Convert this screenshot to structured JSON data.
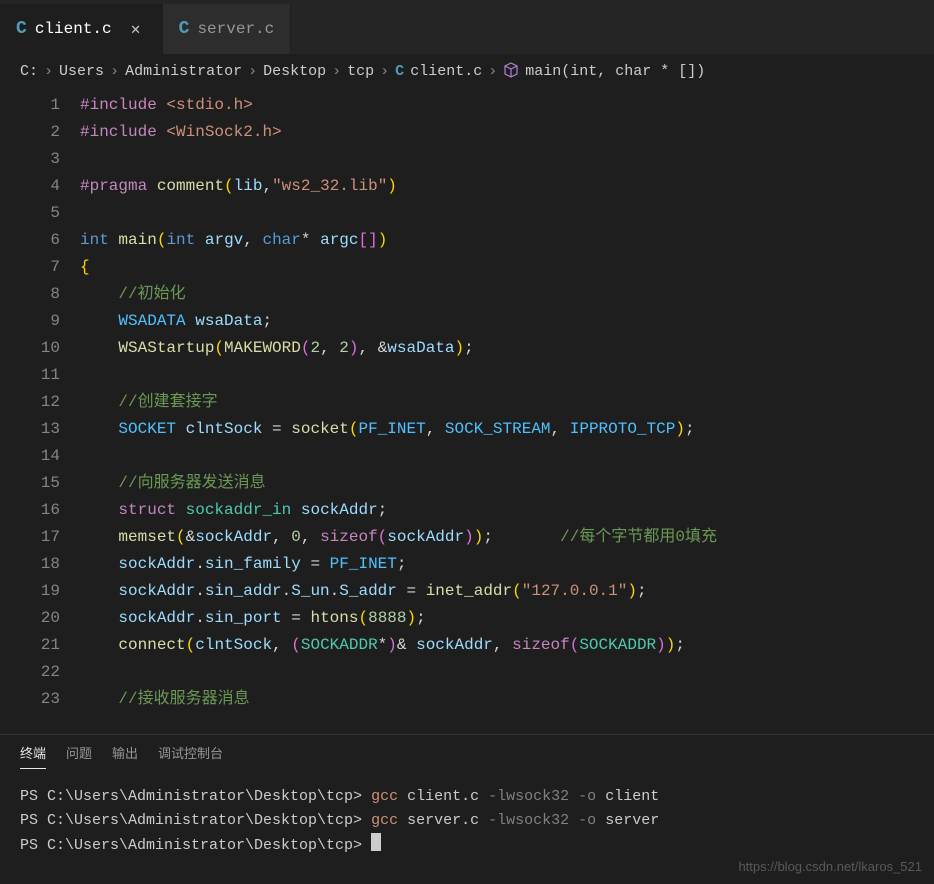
{
  "tabs": [
    {
      "icon": "C",
      "name": "client.c",
      "active": true,
      "closeable": true
    },
    {
      "icon": "C",
      "name": "server.c",
      "active": false,
      "closeable": false
    }
  ],
  "breadcrumb": {
    "parts": [
      "C:",
      "Users",
      "Administrator",
      "Desktop",
      "tcp"
    ],
    "file": "client.c",
    "symbol": "main(int, char * [])"
  },
  "code_lines": [
    {
      "n": 1,
      "tokens": [
        [
          "kw",
          "#include"
        ],
        [
          "ws",
          " "
        ],
        [
          "hdr",
          "<stdio.h>"
        ]
      ]
    },
    {
      "n": 2,
      "tokens": [
        [
          "kw",
          "#include"
        ],
        [
          "ws",
          " "
        ],
        [
          "hdr",
          "<WinSock2.h>"
        ]
      ]
    },
    {
      "n": 3,
      "tokens": []
    },
    {
      "n": 4,
      "tokens": [
        [
          "kw",
          "#pragma"
        ],
        [
          "ws",
          " "
        ],
        [
          "func",
          "comment"
        ],
        [
          "yparen",
          "("
        ],
        [
          "var",
          "lib"
        ],
        [
          "semi",
          ","
        ],
        [
          "str",
          "\"ws2_32.lib\""
        ],
        [
          "yparen",
          ")"
        ]
      ]
    },
    {
      "n": 5,
      "tokens": []
    },
    {
      "n": 6,
      "tokens": [
        [
          "type",
          "int"
        ],
        [
          "ws",
          " "
        ],
        [
          "func",
          "main"
        ],
        [
          "yparen",
          "("
        ],
        [
          "type",
          "int"
        ],
        [
          "ws",
          " "
        ],
        [
          "var",
          "argv"
        ],
        [
          "semi",
          ", "
        ],
        [
          "type",
          "char"
        ],
        [
          "semi",
          "*"
        ],
        [
          "ws",
          " "
        ],
        [
          "var",
          "argc"
        ],
        [
          "pink",
          "["
        ],
        [
          "pink",
          "]"
        ],
        [
          "yparen",
          ")"
        ]
      ]
    },
    {
      "n": 7,
      "tokens": [
        [
          "bracey",
          "{"
        ]
      ]
    },
    {
      "n": 8,
      "tokens": [
        [
          "ws",
          "    "
        ],
        [
          "cmt",
          "//初始化"
        ]
      ]
    },
    {
      "n": 9,
      "tokens": [
        [
          "ws",
          "    "
        ],
        [
          "def",
          "WSADATA"
        ],
        [
          "ws",
          " "
        ],
        [
          "var",
          "wsaData"
        ],
        [
          "semi",
          ";"
        ]
      ]
    },
    {
      "n": 10,
      "tokens": [
        [
          "ws",
          "    "
        ],
        [
          "func",
          "WSAStartup"
        ],
        [
          "yparen",
          "("
        ],
        [
          "func",
          "MAKEWORD"
        ],
        [
          "pink",
          "("
        ],
        [
          "num",
          "2"
        ],
        [
          "semi",
          ", "
        ],
        [
          "num",
          "2"
        ],
        [
          "pink",
          ")"
        ],
        [
          "semi",
          ", "
        ],
        [
          "semi",
          "&"
        ],
        [
          "var",
          "wsaData"
        ],
        [
          "yparen",
          ")"
        ],
        [
          "semi",
          ";"
        ]
      ]
    },
    {
      "n": 11,
      "tokens": []
    },
    {
      "n": 12,
      "tokens": [
        [
          "ws",
          "    "
        ],
        [
          "cmt",
          "//创建套接字"
        ]
      ]
    },
    {
      "n": 13,
      "tokens": [
        [
          "ws",
          "    "
        ],
        [
          "def",
          "SOCKET"
        ],
        [
          "ws",
          " "
        ],
        [
          "var",
          "clntSock"
        ],
        [
          "ws",
          " "
        ],
        [
          "semi",
          "="
        ],
        [
          "ws",
          " "
        ],
        [
          "func",
          "socket"
        ],
        [
          "yparen",
          "("
        ],
        [
          "def",
          "PF_INET"
        ],
        [
          "semi",
          ", "
        ],
        [
          "def",
          "SOCK_STREAM"
        ],
        [
          "semi",
          ", "
        ],
        [
          "def",
          "IPPROTO_TCP"
        ],
        [
          "yparen",
          ")"
        ],
        [
          "semi",
          ";"
        ]
      ]
    },
    {
      "n": 14,
      "tokens": []
    },
    {
      "n": 15,
      "tokens": [
        [
          "ws",
          "    "
        ],
        [
          "cmt",
          "//向服务器发送消息"
        ]
      ]
    },
    {
      "n": 16,
      "tokens": [
        [
          "ws",
          "    "
        ],
        [
          "kw",
          "struct"
        ],
        [
          "ws",
          " "
        ],
        [
          "typeid",
          "sockaddr_in"
        ],
        [
          "ws",
          " "
        ],
        [
          "var",
          "sockAddr"
        ],
        [
          "semi",
          ";"
        ]
      ]
    },
    {
      "n": 17,
      "tokens": [
        [
          "ws",
          "    "
        ],
        [
          "func",
          "memset"
        ],
        [
          "yparen",
          "("
        ],
        [
          "semi",
          "&"
        ],
        [
          "var",
          "sockAddr"
        ],
        [
          "semi",
          ", "
        ],
        [
          "num",
          "0"
        ],
        [
          "semi",
          ", "
        ],
        [
          "kw",
          "sizeof"
        ],
        [
          "pink",
          "("
        ],
        [
          "var",
          "sockAddr"
        ],
        [
          "pink",
          ")"
        ],
        [
          "yparen",
          ")"
        ],
        [
          "semi",
          ";"
        ],
        [
          "ws",
          "       "
        ],
        [
          "cmt",
          "//每个字节都用0填充"
        ]
      ]
    },
    {
      "n": 18,
      "tokens": [
        [
          "ws",
          "    "
        ],
        [
          "var",
          "sockAddr"
        ],
        [
          "semi",
          "."
        ],
        [
          "var",
          "sin_family"
        ],
        [
          "ws",
          " "
        ],
        [
          "semi",
          "="
        ],
        [
          "ws",
          " "
        ],
        [
          "def",
          "PF_INET"
        ],
        [
          "semi",
          ";"
        ]
      ]
    },
    {
      "n": 19,
      "tokens": [
        [
          "ws",
          "    "
        ],
        [
          "var",
          "sockAddr"
        ],
        [
          "semi",
          "."
        ],
        [
          "var",
          "sin_addr"
        ],
        [
          "semi",
          "."
        ],
        [
          "var",
          "S_un"
        ],
        [
          "semi",
          "."
        ],
        [
          "var",
          "S_addr"
        ],
        [
          "ws",
          " "
        ],
        [
          "semi",
          "="
        ],
        [
          "ws",
          " "
        ],
        [
          "func",
          "inet_addr"
        ],
        [
          "yparen",
          "("
        ],
        [
          "str",
          "\"127.0.0.1\""
        ],
        [
          "yparen",
          ")"
        ],
        [
          "semi",
          ";"
        ]
      ]
    },
    {
      "n": 20,
      "tokens": [
        [
          "ws",
          "    "
        ],
        [
          "var",
          "sockAddr"
        ],
        [
          "semi",
          "."
        ],
        [
          "var",
          "sin_port"
        ],
        [
          "ws",
          " "
        ],
        [
          "semi",
          "="
        ],
        [
          "ws",
          " "
        ],
        [
          "func",
          "htons"
        ],
        [
          "yparen",
          "("
        ],
        [
          "num",
          "8888"
        ],
        [
          "yparen",
          ")"
        ],
        [
          "semi",
          ";"
        ]
      ]
    },
    {
      "n": 21,
      "tokens": [
        [
          "ws",
          "    "
        ],
        [
          "func",
          "connect"
        ],
        [
          "yparen",
          "("
        ],
        [
          "var",
          "clntSock"
        ],
        [
          "semi",
          ", "
        ],
        [
          "pink",
          "("
        ],
        [
          "typeid",
          "SOCKADDR"
        ],
        [
          "semi",
          "*"
        ],
        [
          "pink",
          ")"
        ],
        [
          "semi",
          "& "
        ],
        [
          "var",
          "sockAddr"
        ],
        [
          "semi",
          ", "
        ],
        [
          "kw",
          "sizeof"
        ],
        [
          "pink",
          "("
        ],
        [
          "typeid",
          "SOCKADDR"
        ],
        [
          "pink",
          ")"
        ],
        [
          "yparen",
          ")"
        ],
        [
          "semi",
          ";"
        ]
      ]
    },
    {
      "n": 22,
      "tokens": []
    },
    {
      "n": 23,
      "tokens": [
        [
          "ws",
          "    "
        ],
        [
          "cmt",
          "//接收服务器消息"
        ]
      ]
    }
  ],
  "panel_tabs": [
    {
      "label": "终端",
      "active": true
    },
    {
      "label": "问题",
      "active": false
    },
    {
      "label": "输出",
      "active": false
    },
    {
      "label": "调试控制台",
      "active": false
    }
  ],
  "terminal_lines": [
    {
      "prompt": "PS C:\\Users\\Administrator\\Desktop\\tcp>",
      "cmd": "gcc",
      "args": "client.c",
      "flags": "-lwsock32 -o",
      "target": "client"
    },
    {
      "prompt": "PS C:\\Users\\Administrator\\Desktop\\tcp>",
      "cmd": "gcc",
      "args": "server.c",
      "flags": "-lwsock32 -o",
      "target": "server"
    },
    {
      "prompt": "PS C:\\Users\\Administrator\\Desktop\\tcp>",
      "cursor": true
    }
  ],
  "watermark": "https://blog.csdn.net/lkaros_521"
}
